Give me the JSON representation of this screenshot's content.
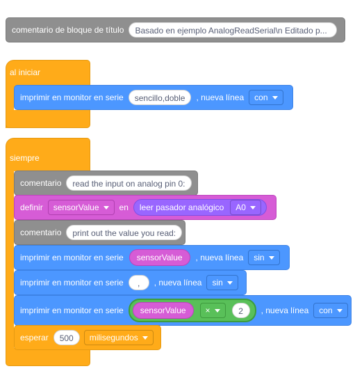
{
  "comment_top": {
    "label": "comentario de bloque de título",
    "value": "Basado en ejemplo AnalogReadSerial\\n Editado p..."
  },
  "setup": {
    "hat_label": "al iniciar",
    "print": {
      "label": "imprimir en monitor en serie",
      "value": "sencillo,doble",
      "newline_label": ", nueva línea",
      "newline_option": "con"
    }
  },
  "forever": {
    "hat_label": "siempre",
    "comment1": {
      "label": "comentario",
      "value": "read the input on analog pin 0:"
    },
    "define": {
      "label": "definir",
      "variable": "sensorValue",
      "in_label": "en",
      "reporter_label": "leer pasador analógico",
      "pin": "A0"
    },
    "comment2": {
      "label": "comentario",
      "value": "print out the value you read:"
    },
    "print1": {
      "label": "imprimir en monitor en serie",
      "value": "sensorValue",
      "newline_label": ", nueva línea",
      "newline_option": "sin"
    },
    "print2": {
      "label": "imprimir en monitor en serie",
      "value": ",",
      "newline_label": ", nueva línea",
      "newline_option": "sin"
    },
    "print3": {
      "label": "imprimir en monitor en serie",
      "value": "sensorValue",
      "operator": "×",
      "operand": "2",
      "newline_label": ", nueva línea",
      "newline_option": "con"
    },
    "wait": {
      "label": "esperar",
      "value": "500",
      "unit": "milisegundos"
    }
  },
  "colors": {
    "comment": "#8f8f8f",
    "print": "#4c97ff",
    "control": "#ffab19",
    "variable": "#d65cd6",
    "sensor": "#9966ff",
    "operator": "#59c059"
  },
  "icons": [
    "dropdown-caret-icon"
  ]
}
